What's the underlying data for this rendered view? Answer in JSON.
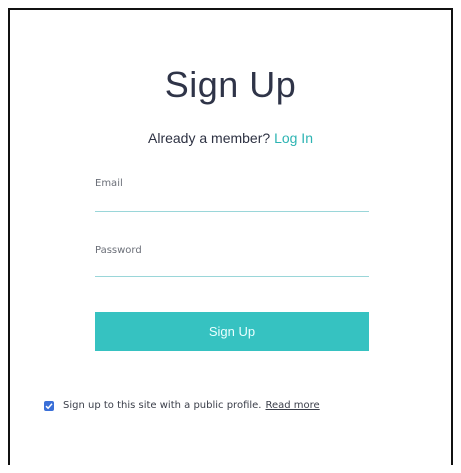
{
  "form": {
    "title": "Sign Up",
    "member_text": "Already a member?",
    "login_link": "Log In",
    "email": {
      "label": "Email",
      "value": ""
    },
    "password": {
      "label": "Password",
      "value": ""
    },
    "submit_label": "Sign Up"
  },
  "public_profile": {
    "checked": true,
    "text": "Sign up to this site with a public profile.",
    "read_more": "Read more"
  },
  "colors": {
    "accent": "#36c2c1",
    "link": "#2db4b3",
    "title": "#2f3448",
    "checkbox": "#3a6fd8"
  },
  "icons": {
    "checkbox": "checkmark-icon"
  }
}
